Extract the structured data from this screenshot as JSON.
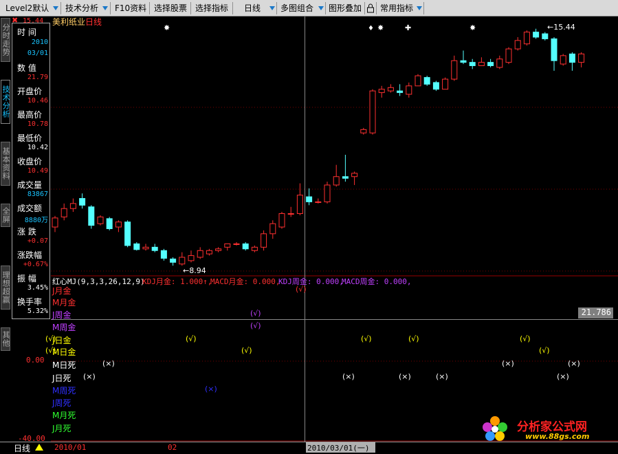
{
  "toolbar": {
    "items": [
      {
        "label": "Level2默认"
      },
      {
        "label": "技术分析"
      },
      {
        "label": "F10资料"
      },
      {
        "label": "选择股票"
      },
      {
        "label": "选择指标"
      },
      {
        "label": "日线"
      },
      {
        "label": "多图组合"
      },
      {
        "label": "图形叠加"
      },
      {
        "label": "常用指标"
      }
    ]
  },
  "side_tabs": [
    {
      "label": "分时走势"
    },
    {
      "label": "技术分析"
    },
    {
      "label": "基本资料"
    },
    {
      "label": "全屏"
    },
    {
      "label": "理想超赢"
    },
    {
      "label": "其他"
    }
  ],
  "stock": {
    "name": "美利纸业",
    "period": "日线"
  },
  "info": {
    "time_label": "时 间",
    "time_year": "2010",
    "time_date": "03/01",
    "value_label": "数 值",
    "value": "21.79",
    "open_label": "开盘价",
    "open": "10.46",
    "high_label": "最高价",
    "high": "10.78",
    "low_label": "最低价",
    "low": "10.42",
    "close_label": "收盘价",
    "close": "10.49",
    "volume_label": "成交量",
    "volume": "83867",
    "amount_label": "成交额",
    "amount": "8880万",
    "change_label": "涨 跌",
    "change": "+0.07",
    "change_pct_label": "涨跌幅",
    "change_pct": "+0.67%",
    "amplitude_label": "振 幅",
    "amplitude": "3.45%",
    "turnover_label": "换手率",
    "turnover": "5.32%"
  },
  "price_axis": {
    "top_label": "15.44"
  },
  "annotations": {
    "high_marker": "15.44",
    "low_marker": "8.94"
  },
  "indicator": {
    "title": "红心MJ(9,3,3,26,12,9)",
    "kdj_month": "KDJ月金: 1.000↑,",
    "macd_month": "MACD月金: 0.000,",
    "kdj_week": "KDJ周金: 0.000,",
    "macd_week": "MACD周金: 0.000,",
    "value_box": "21.786",
    "axis_zero": "0.00",
    "axis_min": "-40.00",
    "rows": [
      {
        "label": "J月金",
        "color": "#ff3030"
      },
      {
        "label": "M月金",
        "color": "#ff3030"
      },
      {
        "label": "J周金",
        "color": "#c040ff"
      },
      {
        "label": "M周金",
        "color": "#c040ff"
      },
      {
        "label": "J日金",
        "color": "#ffff00"
      },
      {
        "label": "M日金",
        "color": "#ffff00"
      },
      {
        "label": "M日死",
        "color": "#ffffff"
      },
      {
        "label": "J日死",
        "color": "#ffffff"
      },
      {
        "label": "M周死",
        "color": "#3030ff"
      },
      {
        "label": "J周死",
        "color": "#3030ff"
      },
      {
        "label": "M月死",
        "color": "#30ff30"
      },
      {
        "label": "J月死",
        "color": "#30ff30"
      }
    ],
    "check_mark": "(√)",
    "cross_mark": "(×)"
  },
  "bottom": {
    "period": "日线",
    "date1": "2010/01",
    "date2": "02",
    "cursor_date": "2010/03/01(一)"
  },
  "watermark": {
    "brand": "分析家公式网",
    "url": "www.88gs.com"
  },
  "candles": [
    [
      9.65,
      9.92,
      9.98,
      9.5
    ],
    [
      9.95,
      10.2,
      10.35,
      9.85
    ],
    [
      10.2,
      10.35,
      10.5,
      10.1
    ],
    [
      10.5,
      10.3,
      10.65,
      10.2
    ],
    [
      10.25,
      9.7,
      10.3,
      9.6
    ],
    [
      9.75,
      9.95,
      10.0,
      9.7
    ],
    [
      9.9,
      9.6,
      9.95,
      9.55
    ],
    [
      9.65,
      9.8,
      9.85,
      9.5
    ],
    [
      9.8,
      9.1,
      9.85,
      9.05
    ],
    [
      9.15,
      8.98,
      9.2,
      8.95
    ],
    [
      9.0,
      9.05,
      9.15,
      8.95
    ],
    [
      9.05,
      8.95,
      9.15,
      8.9
    ],
    [
      8.95,
      8.72,
      9.0,
      8.65
    ],
    [
      8.7,
      8.6,
      8.75,
      8.5
    ],
    [
      8.55,
      8.75,
      8.9,
      8.5
    ],
    [
      8.65,
      8.8,
      8.95,
      8.6
    ],
    [
      8.75,
      8.95,
      9.05,
      8.7
    ],
    [
      8.85,
      8.95,
      9.0,
      8.8
    ],
    [
      8.95,
      9.0,
      9.05,
      8.9
    ],
    [
      9.05,
      9.15,
      9.15,
      8.95
    ],
    [
      9.15,
      9.15,
      9.2,
      9.1
    ],
    [
      9.15,
      9.0,
      9.2,
      8.95
    ],
    [
      8.95,
      9.05,
      9.1,
      8.9
    ],
    [
      9.05,
      9.45,
      9.55,
      8.95
    ],
    [
      9.45,
      9.75,
      9.85,
      9.3
    ],
    [
      9.65,
      10.05,
      10.1,
      9.6
    ],
    [
      10.05,
      10.05,
      10.25,
      9.95
    ],
    [
      10.05,
      10.6,
      10.95,
      10.0
    ],
    [
      10.55,
      10.4,
      10.8,
      10.3
    ],
    [
      10.4,
      10.4,
      10.5,
      10.35
    ],
    [
      10.4,
      10.9,
      11.0,
      10.35
    ],
    [
      10.9,
      11.15,
      11.5,
      10.85
    ],
    [
      11.15,
      11.1,
      11.8,
      11.0
    ],
    [
      11.15,
      11.25,
      11.3,
      10.9
    ],
    [
      12.45,
      12.55,
      12.6,
      12.4
    ],
    [
      12.45,
      13.7,
      13.75,
      12.4
    ],
    [
      13.65,
      13.75,
      13.85,
      13.5
    ],
    [
      13.7,
      13.8,
      13.9,
      13.65
    ],
    [
      13.7,
      13.65,
      13.9,
      13.55
    ],
    [
      13.6,
      13.85,
      13.95,
      13.5
    ],
    [
      13.85,
      14.15,
      14.2,
      13.85
    ],
    [
      14.1,
      13.9,
      14.15,
      13.85
    ],
    [
      13.95,
      13.75,
      14.0,
      13.7
    ],
    [
      13.75,
      14.05,
      14.1,
      13.75
    ],
    [
      14.05,
      14.6,
      14.75,
      14.0
    ],
    [
      14.6,
      14.55,
      14.9,
      14.5
    ],
    [
      14.55,
      14.45,
      14.65,
      14.35
    ],
    [
      14.45,
      14.55,
      14.7,
      14.45
    ],
    [
      14.55,
      14.45,
      14.65,
      14.4
    ],
    [
      14.4,
      14.65,
      14.75,
      14.35
    ],
    [
      14.55,
      14.95,
      15.0,
      14.5
    ],
    [
      14.95,
      15.2,
      15.3,
      14.9
    ],
    [
      15.1,
      15.45,
      15.5,
      15.05
    ],
    [
      15.45,
      15.3,
      15.55,
      15.25
    ],
    [
      15.4,
      15.25,
      15.45,
      15.2
    ],
    [
      15.25,
      14.6,
      15.3,
      14.3
    ],
    [
      14.5,
      14.75,
      14.8,
      14.45
    ],
    [
      14.8,
      14.55,
      14.85,
      14.3
    ],
    [
      14.55,
      14.8,
      14.85,
      14.4
    ]
  ]
}
